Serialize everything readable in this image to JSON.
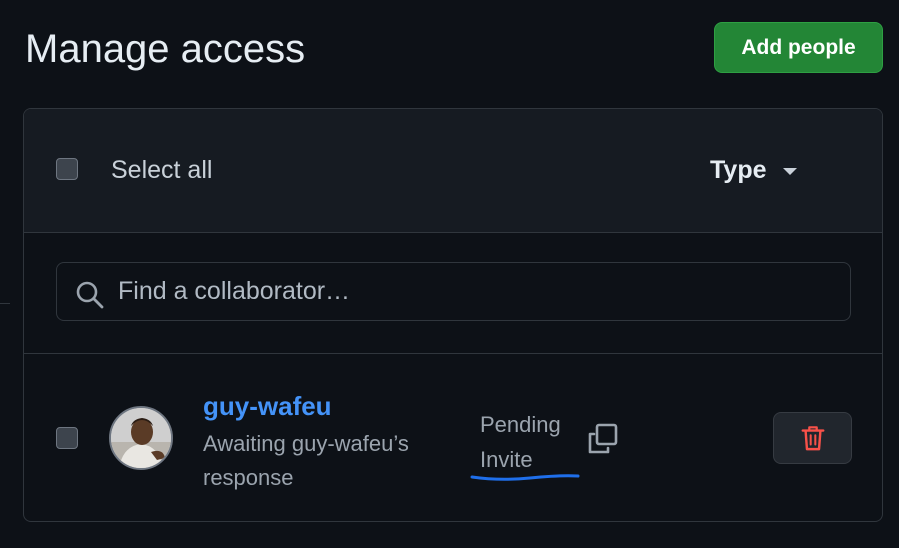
{
  "header": {
    "title": "Manage access",
    "add_button_label": "Add people"
  },
  "table": {
    "select_all_label": "Select all",
    "type_filter_label": "Type"
  },
  "search": {
    "placeholder": "Find a collaborator…"
  },
  "members": [
    {
      "username": "guy-wafeu",
      "status_line1": "Awaiting guy-wafeu’s",
      "status_line2": "response",
      "invite_line1": "Pending",
      "invite_line2": "Invite"
    }
  ],
  "icons": {
    "search": "search-icon",
    "caret": "caret-down-icon",
    "copy": "copy-icon",
    "delete": "trash-icon"
  },
  "colors": {
    "primary_button": "#238636",
    "link": "#4493f8",
    "danger": "#f85149",
    "annotation": "#1f6feb"
  }
}
